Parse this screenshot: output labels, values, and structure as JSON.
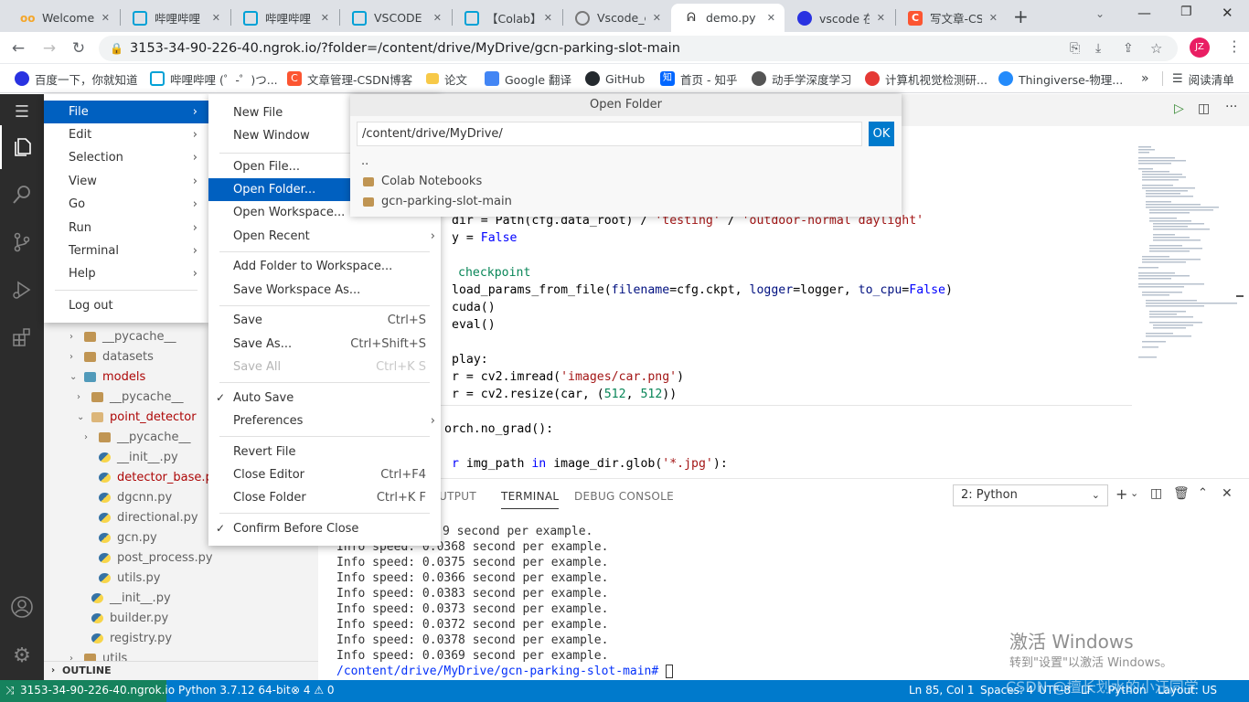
{
  "browser": {
    "tabs": [
      {
        "title": "Welcome",
        "favicon_color": "#f4a62a"
      },
      {
        "title": "哔哩哔哩 (",
        "favicon_color": "#00a1d6"
      },
      {
        "title": "哔哩哔哩 (",
        "favicon_color": "#00a1d6"
      },
      {
        "title": "VSCODE (",
        "favicon_color": "#00a1d6"
      },
      {
        "title": "【Colab】",
        "favicon_color": "#00a1d6"
      },
      {
        "title": "Vscode_cc",
        "favicon_color": "#777777"
      },
      {
        "title": "demo.py",
        "favicon_color": "#333333",
        "active": true
      },
      {
        "title": "vscode 在",
        "favicon_color": "#2932e1"
      },
      {
        "title": "写文章-CS",
        "favicon_color": "#fc5531"
      }
    ],
    "new_tab": "+",
    "url": "3153-34-90-226-40.ngrok.io/?folder=/content/drive/MyDrive/gcn-parking-slot-main",
    "profile_initials": "JZ",
    "bookmarks": [
      {
        "label": "百度一下，你就知道",
        "color": "#2932e1"
      },
      {
        "label": "哔哩哔哩 (゜-゜)つ...",
        "color": "#00a1d6"
      },
      {
        "label": "文章管理-CSDN博客",
        "color": "#fc5531"
      },
      {
        "label": "论文",
        "color": "#f7c948"
      },
      {
        "label": "Google 翻译",
        "color": "#4285f4"
      },
      {
        "label": "GitHub",
        "color": "#24292e"
      },
      {
        "label": "首页 - 知乎",
        "color": "#0066ff"
      },
      {
        "label": "动手学深度学习",
        "color": "#555555"
      },
      {
        "label": "计算机视觉检测研...",
        "color": "#e53935"
      },
      {
        "label": "Thingiverse-物理...",
        "color": "#248bfb"
      }
    ],
    "bookmarks_more": "»",
    "reading_list": "阅读清单"
  },
  "file_menu": {
    "items": [
      {
        "label": "File",
        "selected": true
      },
      {
        "label": "Edit"
      },
      {
        "label": "Selection"
      },
      {
        "label": "View"
      },
      {
        "label": "Go"
      },
      {
        "label": "Run"
      },
      {
        "label": "Terminal"
      },
      {
        "label": "Help"
      }
    ],
    "logout": "Log out"
  },
  "file_submenu": {
    "new_file": "New File",
    "new_window": "New Window",
    "open_file": "Open File...",
    "open_folder": "Open Folder...",
    "open_workspace": "Open Workspace...",
    "open_recent": "Open Recent",
    "add_folder": "Add Folder to Workspace...",
    "save_workspace_as": "Save Workspace As...",
    "save": "Save",
    "save_kb": "Ctrl+S",
    "save_as": "Save As...",
    "save_as_kb": "Ctrl+Shift+S",
    "save_all": "Save All",
    "save_all_kb": "Ctrl+K S",
    "auto_save": "Auto Save",
    "preferences": "Preferences",
    "revert_file": "Revert File",
    "close_editor": "Close Editor",
    "close_editor_kb": "Ctrl+F4",
    "close_folder": "Close Folder",
    "close_folder_kb": "Ctrl+K F",
    "confirm_before_close": "Confirm Before Close"
  },
  "open_folder_dialog": {
    "title": "Open Folder",
    "path": "/content/drive/MyDrive/",
    "ok": "OK",
    "entries": [
      "..",
      "Colab Notebooks",
      "gcn-parking-slot-main"
    ]
  },
  "explorer": {
    "items": [
      {
        "label": "__pycache__",
        "type": "folder"
      },
      {
        "label": "datasets",
        "type": "folder"
      },
      {
        "label": "models",
        "type": "folder",
        "open": true,
        "modified": true
      },
      {
        "label": "__pycache__",
        "type": "folder"
      },
      {
        "label": "point_detector",
        "type": "folder",
        "open": true,
        "modified": true
      },
      {
        "label": "__pycache__",
        "type": "folder"
      },
      {
        "label": "__init__.py",
        "type": "py"
      },
      {
        "label": "detector_base.py",
        "type": "py",
        "modified": true
      },
      {
        "label": "dgcnn.py",
        "type": "py"
      },
      {
        "label": "directional.py",
        "type": "py"
      },
      {
        "label": "gcn.py",
        "type": "py"
      },
      {
        "label": "post_process.py",
        "type": "py"
      },
      {
        "label": "utils.py",
        "type": "py"
      },
      {
        "label": "__init__.py",
        "type": "py"
      },
      {
        "label": "builder.py",
        "type": "py"
      },
      {
        "label": "registry.py",
        "type": "py"
      },
      {
        "label": "utils",
        "type": "folder"
      }
    ],
    "outline": "OUTLINE"
  },
  "editor": {
    "lines": {
      "l1a": "dir = Path(cfg.data_root) / ",
      "l1b": "'testing'",
      "l1c": " / ",
      "l1d": "'outdoor-normal daylight'",
      "l2a": "y = ",
      "l2b": "False",
      "l3": "checkpoint",
      "l4a": "load_params_from_file(",
      "l4b": "filename",
      "l4c": "=cfg.ckpt, ",
      "l4d": "logger",
      "l4e": "=logger, ",
      "l4f": "to_cpu",
      "l4g": "=",
      "l4h": "False",
      "l4i": ")",
      "l5": "cuda()",
      "l6": "eval()",
      "l7": "play:",
      "l8a": "r = cv2.imread(",
      "l8b": "'images/car.png'",
      "l8c": ")",
      "l9a": "r = cv2.resize(car, (",
      "l9b": "512",
      "l9c": ", ",
      "l9d": "512",
      "l9e": "))",
      "l10": "orch.no_grad():",
      "l11a": "r",
      "l11b": " img_path ",
      "l11c": "in",
      "l11d": " image_dir.glob(",
      "l11e": "'*.jpg'",
      "l11f": "):"
    }
  },
  "panel": {
    "tabs": [
      "UTPUT",
      "TERMINAL",
      "DEBUG CONSOLE"
    ],
    "active_tab": "TERMINAL",
    "terminal_select": "2: Python",
    "lines": [
      "9 second per example.",
      "Info speed: 0.0368 second per example.",
      "Info speed: 0.0375 second per example.",
      "Info speed: 0.0366 second per example.",
      "Info speed: 0.0383 second per example.",
      "Info speed: 0.0373 second per example.",
      "Info speed: 0.0372 second per example.",
      "Info speed: 0.0378 second per example.",
      "Info speed: 0.0369 second per example."
    ],
    "prompt": "/content/drive/MyDrive/gcn-parking-slot-main#"
  },
  "statusbar": {
    "remote": "3153-34-90-226-40.ngrok.io",
    "python": "Python 3.7.12 64-bit",
    "problems": "⊗ 4 ⚠ 0",
    "position": "Ln 85, Col 1",
    "spaces": "Spaces: 4",
    "encoding": "UTF-8",
    "eol": "LF",
    "language": "Python",
    "layout": "Layout: US"
  },
  "watermark": {
    "line1": "激活 Windows",
    "line2": "转到\"设置\"以激活 Windows。",
    "csdn": "CSDN @擅长划水的小汪同学"
  }
}
